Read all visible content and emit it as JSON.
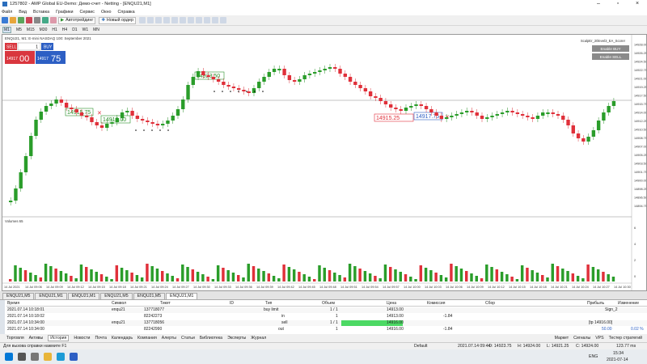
{
  "window": {
    "title": "1257802 - AMP Global EU-Demo: Демо-счет - Netting - [ENQU21,M1]"
  },
  "menu": [
    "Файл",
    "Вид",
    "Вставка",
    "Графики",
    "Сервис",
    "Окно",
    "Справка"
  ],
  "toolbar": {
    "algo": "Автотрейдинг",
    "new_order": "Новый ордер"
  },
  "timeframes": [
    "M1",
    "M5",
    "M15",
    "M30",
    "H1",
    "H4",
    "D1",
    "W1",
    "MN"
  ],
  "chart": {
    "symbol_line": "ENQU21, M1: E-mini NASDAQ 100: September 2021",
    "ea_label": "ScalpEr_20level3_EA_Scorer",
    "btn_buy": "Enable BUY",
    "btn_sell": "Enable SELL",
    "oneclick": {
      "sell": "SELL",
      "buy": "BUY",
      "lot": "1",
      "bid_big": "14917",
      "bid_small": "00",
      "ask_big": "14917",
      "ask_small": "75"
    },
    "labels": [
      "14915.75",
      "14913.00",
      "14923.50",
      "14915.25",
      "14917.75"
    ],
    "price_ticks": [
      "14928.00",
      "14926.25",
      "14924.50",
      "14922.75",
      "14921.00",
      "14919.25",
      "14917.50",
      "14915.75",
      "14914.00",
      "14912.25",
      "14910.50",
      "14908.75",
      "14907.00",
      "14905.25",
      "14903.50",
      "14901.75",
      "14900.00",
      "14898.25",
      "14896.50",
      "14894.75"
    ],
    "volume_label": "Volumes 65",
    "volume_ticks": [
      "6",
      "4",
      "2",
      "0"
    ],
    "time_ticks": [
      "14 Jul 2021",
      "14 Jul 09:06",
      "14 Jul 09:09",
      "14 Jul 09:12",
      "14 Jul 09:15",
      "14 Jul 09:18",
      "14 Jul 09:21",
      "14 Jul 09:24",
      "14 Jul 09:27",
      "14 Jul 09:30",
      "14 Jul 09:33",
      "14 Jul 09:36",
      "14 Jul 09:39",
      "14 Jul 09:42",
      "14 Jul 09:45",
      "14 Jul 09:48",
      "14 Jul 09:51",
      "14 Jul 09:54",
      "14 Jul 09:57",
      "14 Jul 10:00",
      "14 Jul 10:03",
      "14 Jul 10:06",
      "14 Jul 10:09",
      "14 Jul 10:12",
      "14 Jul 10:15",
      "14 Jul 10:18",
      "14 Jul 10:21",
      "14 Jul 10:24",
      "14 Jul 10:27",
      "14 Jul 10:30"
    ]
  },
  "chart_tabs": [
    "ENQU21,M5",
    "ENQU21,M1",
    "ENQU21,M1",
    "ENQU21,M5",
    "ENQU21,M5",
    "ENQU21,M1"
  ],
  "table": {
    "headers": [
      "Время",
      "Символ",
      "Тикет",
      "ID",
      "Тип",
      "Объем",
      "Цена",
      "Комиссия",
      "Сбор",
      "Прибыль",
      "Изменение"
    ],
    "rows": [
      {
        "time": "2021.07.14 10:18:01",
        "symbol": "enqu21",
        "ticket": "137718077",
        "type": "buy limit",
        "vol": "1 / 1",
        "price": "14913.00",
        "comm": "",
        "profit": "Sign_2"
      },
      {
        "time": "2021.07.14 10:18:02",
        "symbol": "",
        "ticket": "82242273",
        "type": "in",
        "vol": "1",
        "price": "14913.00",
        "comm": "-1.84",
        "profit": ""
      },
      {
        "time": "2021.07.14 10:34:00",
        "symbol": "enqu21",
        "ticket": "137718056",
        "type": "sell",
        "vol": "1 / 1",
        "price": "14916.00",
        "comm": "",
        "profit": "[tp 14916.00]"
      },
      {
        "time": "2021.07.14 10:34:00",
        "symbol": "",
        "ticket": "82242990",
        "type": "out",
        "vol": "1",
        "price": "14916.00",
        "comm": "-1.84",
        "profit": "50.00"
      }
    ],
    "extra": "0.02 %"
  },
  "bottom_tabs": [
    "Торговля",
    "Активы",
    "История",
    "Новости",
    "Почта",
    "Календарь",
    "Компания",
    "Алерты",
    "Статьи",
    "Библиотека",
    "Эксперты",
    "Журнал"
  ],
  "bottom_right": [
    "Маркет",
    "Сигналы",
    "VPS",
    "Тестер стратегий"
  ],
  "status": {
    "help": "Для вызова справки нажмите F1",
    "profile": "Default",
    "datetime": "2021.07.14 09:44",
    "o": "O: 14923.75",
    "h": "H: 14924.00",
    "l": "L: 14921.25",
    "c": "C: 14924.00",
    "ping": "123.77 ms"
  },
  "taskbar": {
    "time": "15:34",
    "date": "2021-07-14",
    "lang": "ENG"
  }
}
